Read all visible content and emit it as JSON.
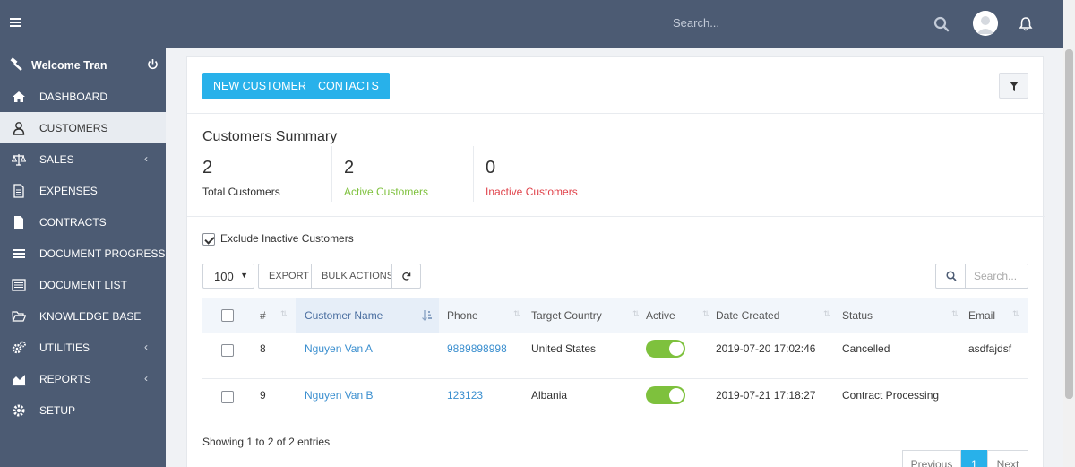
{
  "topbar": {
    "search_placeholder": "Search..."
  },
  "sidebar": {
    "welcome": "Welcome Tran",
    "items": [
      {
        "label": "DASHBOARD",
        "icon": "home-icon"
      },
      {
        "label": "CUSTOMERS",
        "icon": "user-icon",
        "active": true
      },
      {
        "label": "SALES",
        "icon": "balance-scale-icon",
        "has_submenu": true
      },
      {
        "label": "EXPENSES",
        "icon": "file-text-icon"
      },
      {
        "label": "CONTRACTS",
        "icon": "file-icon"
      },
      {
        "label": "DOCUMENT PROGRESS",
        "icon": "bars-icon"
      },
      {
        "label": "DOCUMENT LIST",
        "icon": "list-icon"
      },
      {
        "label": "KNOWLEDGE BASE",
        "icon": "folder-open-icon"
      },
      {
        "label": "UTILITIES",
        "icon": "cogs-icon",
        "has_submenu": true
      },
      {
        "label": "REPORTS",
        "icon": "area-chart-icon",
        "has_submenu": true
      },
      {
        "label": "SETUP",
        "icon": "gear-icon"
      }
    ]
  },
  "toolbar": {
    "new_customer": "NEW CUSTOMER",
    "contacts": "CONTACTS"
  },
  "summary": {
    "title": "Customers Summary",
    "total": {
      "value": "2",
      "label": "Total Customers"
    },
    "active": {
      "value": "2",
      "label": "Active Customers"
    },
    "inactive": {
      "value": "0",
      "label": "Inactive Customers"
    }
  },
  "filters": {
    "exclude_inactive_label": "Exclude Inactive Customers",
    "exclude_inactive_checked": true
  },
  "table_tools": {
    "page_length": "100",
    "export": "EXPORT",
    "bulk_actions": "BULK ACTIONS",
    "search_placeholder": "Search..."
  },
  "table": {
    "columns": [
      "#",
      "Customer Name",
      "Phone",
      "Target Country",
      "Active",
      "Date Created",
      "Status",
      "Email"
    ],
    "rows": [
      {
        "id": "8",
        "name": "Nguyen Van A",
        "phone": "9889898998",
        "country": "United States",
        "active": true,
        "date": "2019-07-20 17:02:46",
        "status": "Cancelled",
        "email": "asdfajdsf"
      },
      {
        "id": "9",
        "name": "Nguyen Van B",
        "phone": "123123",
        "country": "Albania",
        "active": true,
        "date": "2019-07-21 17:18:27",
        "status": "Contract Processing",
        "email": ""
      }
    ],
    "info": "Showing 1 to 2 of 2 entries"
  },
  "pagination": {
    "previous": "Previous",
    "current": "1",
    "next": "Next"
  },
  "colors": {
    "topbar": "#4c5b73",
    "primary": "#28b1ea",
    "active_green": "#7ec13d",
    "inactive_red": "#e0434b",
    "link": "#3b8fcf"
  }
}
